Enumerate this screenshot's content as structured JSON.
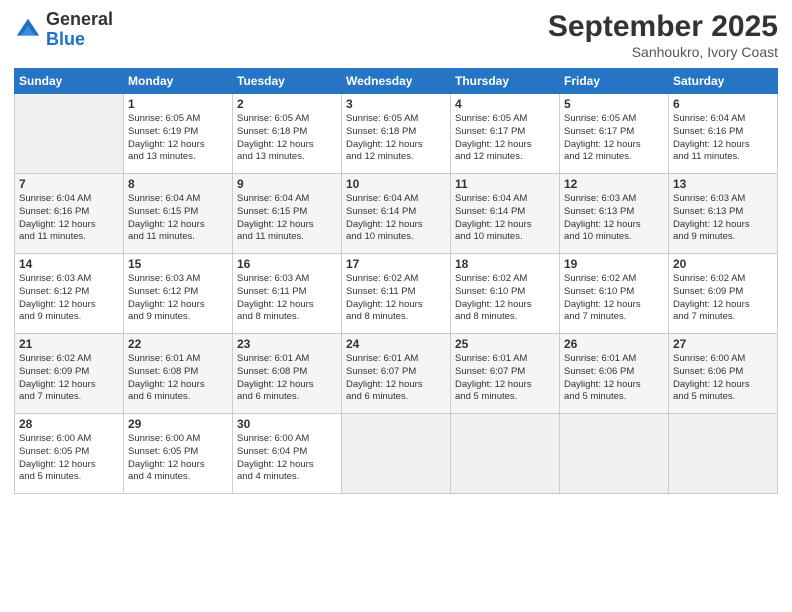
{
  "logo": {
    "general": "General",
    "blue": "Blue"
  },
  "header": {
    "month": "September 2025",
    "location": "Sanhoukro, Ivory Coast"
  },
  "days_of_week": [
    "Sunday",
    "Monday",
    "Tuesday",
    "Wednesday",
    "Thursday",
    "Friday",
    "Saturday"
  ],
  "weeks": [
    [
      {
        "day": "",
        "info": ""
      },
      {
        "day": "1",
        "info": "Sunrise: 6:05 AM\nSunset: 6:19 PM\nDaylight: 12 hours\nand 13 minutes."
      },
      {
        "day": "2",
        "info": "Sunrise: 6:05 AM\nSunset: 6:18 PM\nDaylight: 12 hours\nand 13 minutes."
      },
      {
        "day": "3",
        "info": "Sunrise: 6:05 AM\nSunset: 6:18 PM\nDaylight: 12 hours\nand 12 minutes."
      },
      {
        "day": "4",
        "info": "Sunrise: 6:05 AM\nSunset: 6:17 PM\nDaylight: 12 hours\nand 12 minutes."
      },
      {
        "day": "5",
        "info": "Sunrise: 6:05 AM\nSunset: 6:17 PM\nDaylight: 12 hours\nand 12 minutes."
      },
      {
        "day": "6",
        "info": "Sunrise: 6:04 AM\nSunset: 6:16 PM\nDaylight: 12 hours\nand 11 minutes."
      }
    ],
    [
      {
        "day": "7",
        "info": "Sunrise: 6:04 AM\nSunset: 6:16 PM\nDaylight: 12 hours\nand 11 minutes."
      },
      {
        "day": "8",
        "info": "Sunrise: 6:04 AM\nSunset: 6:15 PM\nDaylight: 12 hours\nand 11 minutes."
      },
      {
        "day": "9",
        "info": "Sunrise: 6:04 AM\nSunset: 6:15 PM\nDaylight: 12 hours\nand 11 minutes."
      },
      {
        "day": "10",
        "info": "Sunrise: 6:04 AM\nSunset: 6:14 PM\nDaylight: 12 hours\nand 10 minutes."
      },
      {
        "day": "11",
        "info": "Sunrise: 6:04 AM\nSunset: 6:14 PM\nDaylight: 12 hours\nand 10 minutes."
      },
      {
        "day": "12",
        "info": "Sunrise: 6:03 AM\nSunset: 6:13 PM\nDaylight: 12 hours\nand 10 minutes."
      },
      {
        "day": "13",
        "info": "Sunrise: 6:03 AM\nSunset: 6:13 PM\nDaylight: 12 hours\nand 9 minutes."
      }
    ],
    [
      {
        "day": "14",
        "info": "Sunrise: 6:03 AM\nSunset: 6:12 PM\nDaylight: 12 hours\nand 9 minutes."
      },
      {
        "day": "15",
        "info": "Sunrise: 6:03 AM\nSunset: 6:12 PM\nDaylight: 12 hours\nand 9 minutes."
      },
      {
        "day": "16",
        "info": "Sunrise: 6:03 AM\nSunset: 6:11 PM\nDaylight: 12 hours\nand 8 minutes."
      },
      {
        "day": "17",
        "info": "Sunrise: 6:02 AM\nSunset: 6:11 PM\nDaylight: 12 hours\nand 8 minutes."
      },
      {
        "day": "18",
        "info": "Sunrise: 6:02 AM\nSunset: 6:10 PM\nDaylight: 12 hours\nand 8 minutes."
      },
      {
        "day": "19",
        "info": "Sunrise: 6:02 AM\nSunset: 6:10 PM\nDaylight: 12 hours\nand 7 minutes."
      },
      {
        "day": "20",
        "info": "Sunrise: 6:02 AM\nSunset: 6:09 PM\nDaylight: 12 hours\nand 7 minutes."
      }
    ],
    [
      {
        "day": "21",
        "info": "Sunrise: 6:02 AM\nSunset: 6:09 PM\nDaylight: 12 hours\nand 7 minutes."
      },
      {
        "day": "22",
        "info": "Sunrise: 6:01 AM\nSunset: 6:08 PM\nDaylight: 12 hours\nand 6 minutes."
      },
      {
        "day": "23",
        "info": "Sunrise: 6:01 AM\nSunset: 6:08 PM\nDaylight: 12 hours\nand 6 minutes."
      },
      {
        "day": "24",
        "info": "Sunrise: 6:01 AM\nSunset: 6:07 PM\nDaylight: 12 hours\nand 6 minutes."
      },
      {
        "day": "25",
        "info": "Sunrise: 6:01 AM\nSunset: 6:07 PM\nDaylight: 12 hours\nand 5 minutes."
      },
      {
        "day": "26",
        "info": "Sunrise: 6:01 AM\nSunset: 6:06 PM\nDaylight: 12 hours\nand 5 minutes."
      },
      {
        "day": "27",
        "info": "Sunrise: 6:00 AM\nSunset: 6:06 PM\nDaylight: 12 hours\nand 5 minutes."
      }
    ],
    [
      {
        "day": "28",
        "info": "Sunrise: 6:00 AM\nSunset: 6:05 PM\nDaylight: 12 hours\nand 5 minutes."
      },
      {
        "day": "29",
        "info": "Sunrise: 6:00 AM\nSunset: 6:05 PM\nDaylight: 12 hours\nand 4 minutes."
      },
      {
        "day": "30",
        "info": "Sunrise: 6:00 AM\nSunset: 6:04 PM\nDaylight: 12 hours\nand 4 minutes."
      },
      {
        "day": "",
        "info": ""
      },
      {
        "day": "",
        "info": ""
      },
      {
        "day": "",
        "info": ""
      },
      {
        "day": "",
        "info": ""
      }
    ]
  ]
}
